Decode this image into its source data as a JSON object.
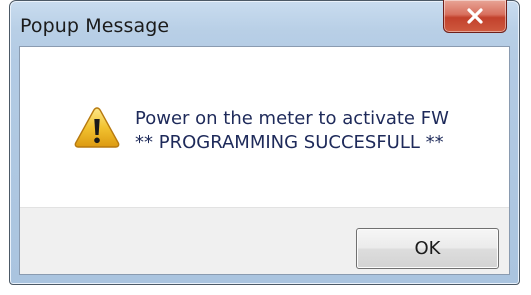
{
  "window": {
    "title": "Popup Message",
    "close_icon": "close-icon"
  },
  "message": {
    "icon": "warning-icon",
    "line1": "Power on the meter to activate FW",
    "line2": "** PROGRAMMING SUCCESFULL **"
  },
  "footer": {
    "ok_label": "OK"
  },
  "colors": {
    "close_button": "#c2412c",
    "message_text": "#1e2a5a",
    "warning_fill": "#f2c230"
  }
}
